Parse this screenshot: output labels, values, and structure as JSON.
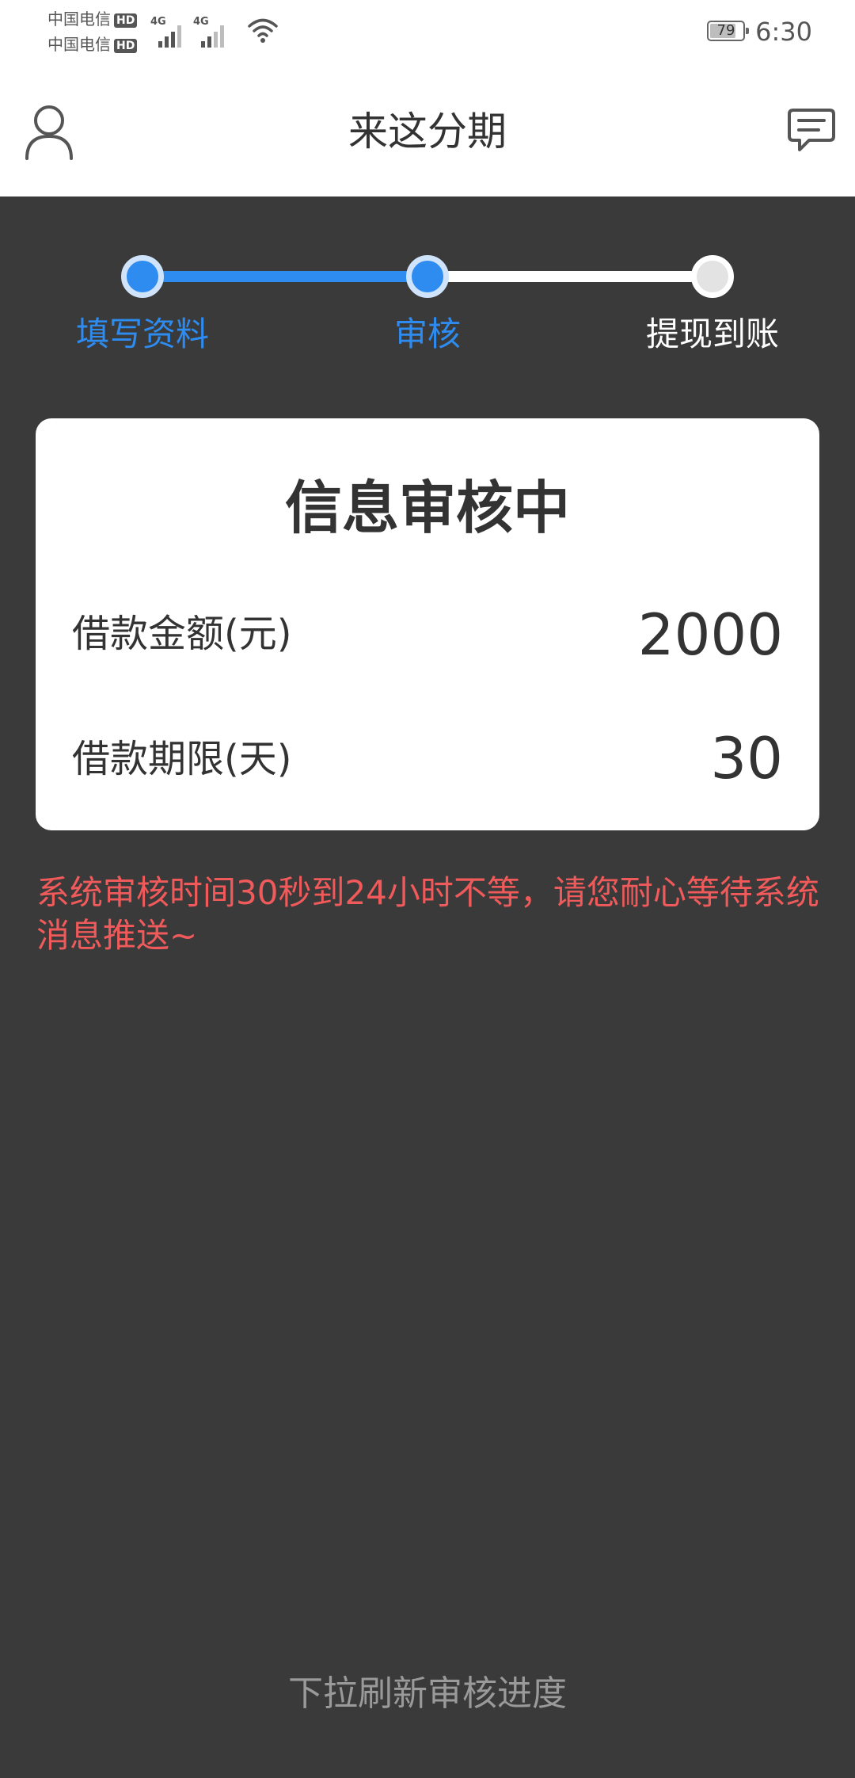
{
  "status_bar": {
    "carrier_1": "中国电信",
    "carrier_2": "中国电信",
    "hd_badge": "HD",
    "network_1": "4G",
    "network_2": "4G",
    "battery_level": "79",
    "battery_fraction": 0.79,
    "time": "6:30"
  },
  "nav": {
    "title": "来这分期",
    "left_icon": "user-icon",
    "right_icon": "message-icon"
  },
  "stepper": {
    "steps": [
      {
        "label": "填写资料",
        "state": "done"
      },
      {
        "label": "审核",
        "state": "current"
      },
      {
        "label": "提现到账",
        "state": "pending"
      }
    ],
    "active_color": "#2e8cf0",
    "inactive_color": "#ffffff"
  },
  "card": {
    "title": "信息审核中",
    "rows": [
      {
        "label": "借款金额(元)",
        "value": "2000"
      },
      {
        "label": "借款期限(天)",
        "value": "30"
      }
    ]
  },
  "notice": "系统审核时间30秒到24小时不等，请您耐心等待系统消息推送~",
  "refresh_hint": "下拉刷新审核进度",
  "colors": {
    "background": "#3a3a3b",
    "accent": "#2e8cf0",
    "notice": "#f05a5a"
  }
}
